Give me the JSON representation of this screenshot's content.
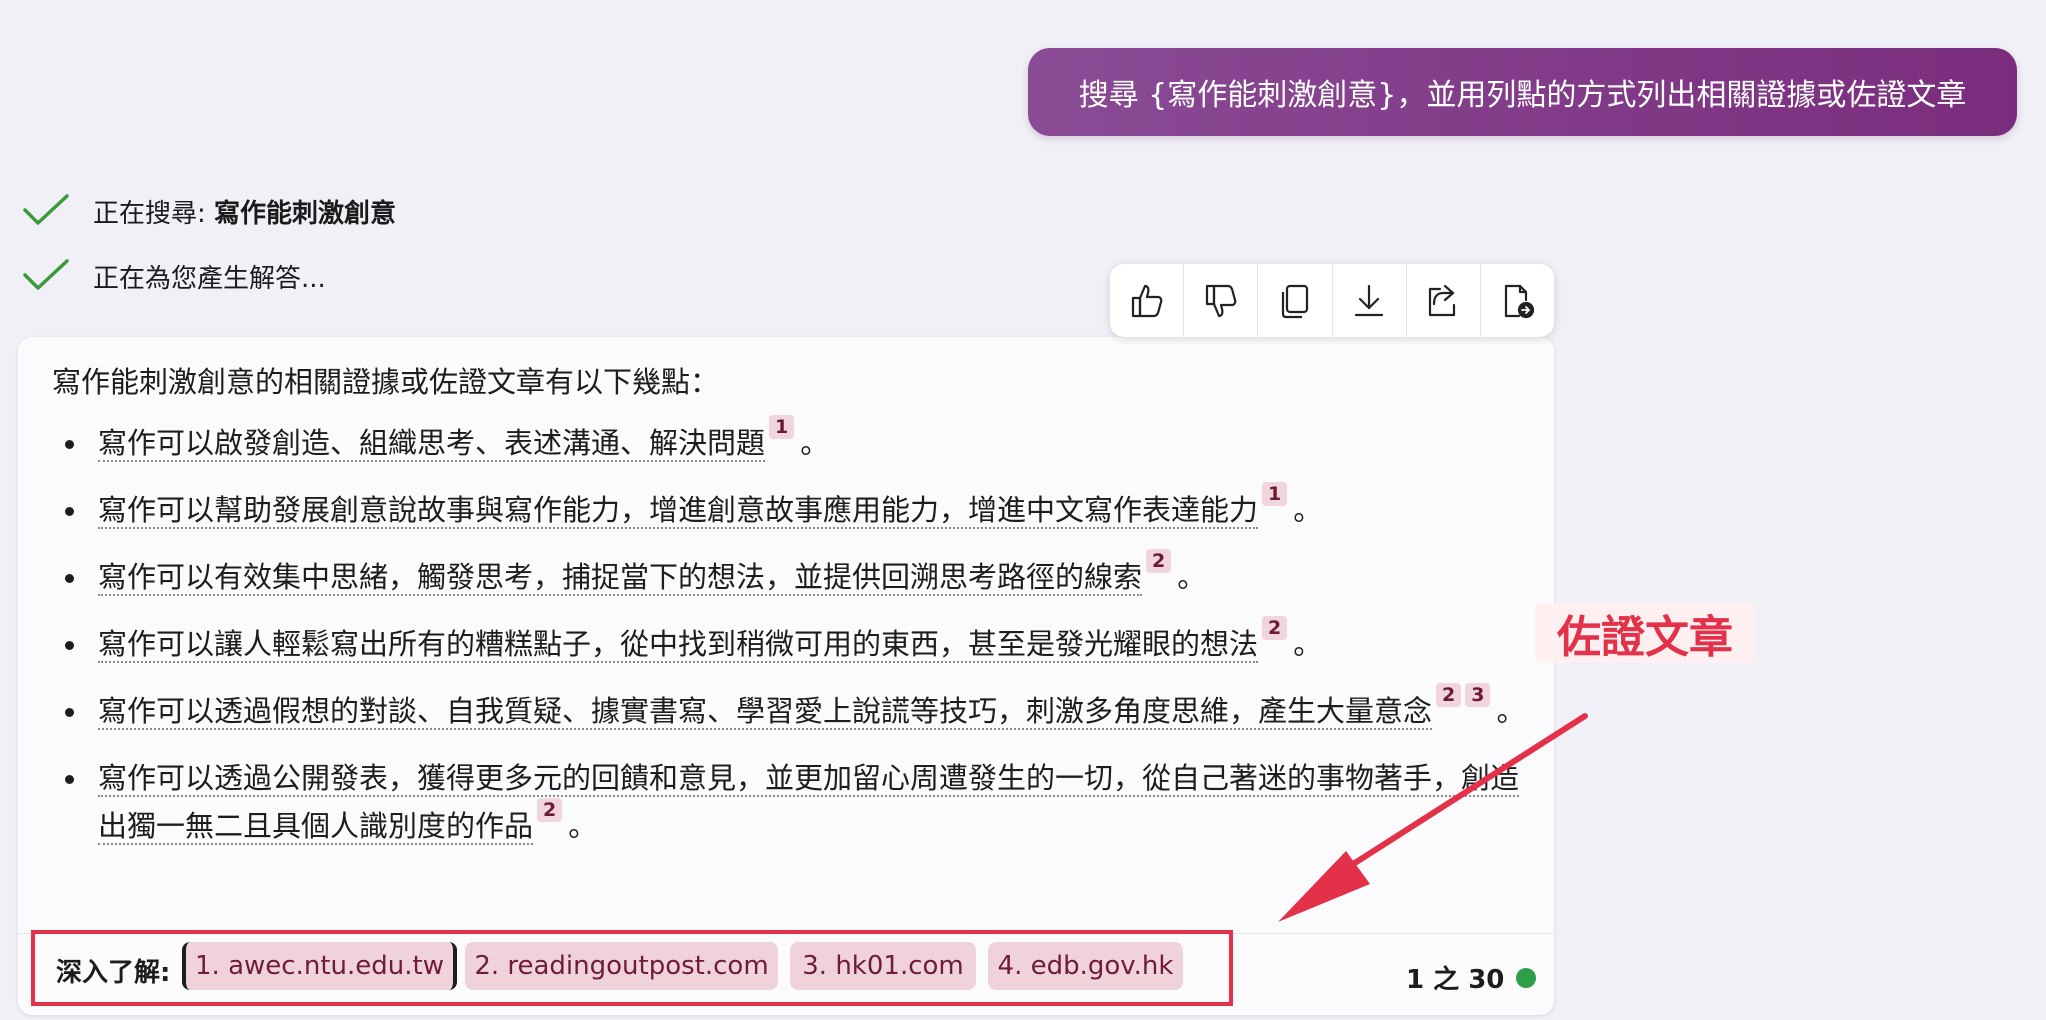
{
  "user_query": "搜尋 {寫作能刺激創意}，並用列點的方式列出相關證據或佐證文章",
  "status": [
    {
      "icon": "checkmark-icon",
      "prefix": "正在搜尋: ",
      "bold": "寫作能刺激創意"
    },
    {
      "icon": "checkmark-icon",
      "prefix": "正在為您產生解答...",
      "bold": ""
    }
  ],
  "toolbar": {
    "buttons": [
      "thumbs-up-icon",
      "thumbs-down-icon",
      "copy-icon",
      "download-icon",
      "share-icon",
      "export-icon"
    ]
  },
  "answer": {
    "intro": "寫作能刺激創意的相關證據或佐證文章有以下幾點：",
    "bullets": [
      {
        "text": "寫作可以啟發創造、組織思考、表述溝通、解決問題",
        "cites": [
          "1"
        ],
        "end": "。"
      },
      {
        "text": "寫作可以幫助發展創意說故事與寫作能力，增進創意故事應用能力，增進中文寫作表達能力",
        "cites": [
          "1"
        ],
        "end": "。"
      },
      {
        "text": "寫作可以有效集中思緒，觸發思考，捕捉當下的想法，並提供回溯思考路徑的線索",
        "cites": [
          "2"
        ],
        "end": "。"
      },
      {
        "text": "寫作可以讓人輕鬆寫出所有的糟糕點子，從中找到稍微可用的東西，甚至是發光耀眼的想法",
        "cites": [
          "2"
        ],
        "end": "。"
      },
      {
        "text": "寫作可以透過假想的對談、自我質疑、據實書寫、學習愛上說謊等技巧，刺激多角度思維，產生大量意念",
        "cites": [
          "2",
          "3"
        ],
        "end": "。"
      },
      {
        "text": "寫作可以透過公開發表，獲得更多元的回饋和意見，並更加留心周遭發生的一切，從自己著迷的事物著手，創造出獨一無二且具個人識別度的作品",
        "cites": [
          "2"
        ],
        "end": "。"
      }
    ]
  },
  "learn_more": {
    "label": "深入了解:",
    "sources": [
      "1. awec.ntu.edu.tw",
      "2. readingoutpost.com",
      "3. hk01.com",
      "4. edb.gov.hk"
    ]
  },
  "page_count": "1 之 30",
  "annotation": {
    "label": "佐證文章",
    "color": "#e3314a"
  },
  "colors": {
    "user_bubble": "#7a2d7c",
    "citation_bg": "#f1d5dc",
    "check_green": "#3a9a3a",
    "status_dot": "#2f9e4a"
  }
}
